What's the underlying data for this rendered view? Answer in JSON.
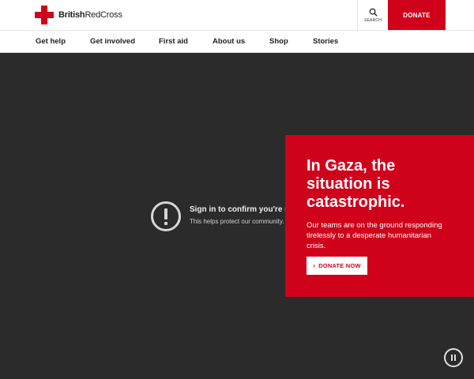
{
  "header": {
    "logo_text_bold": "British",
    "logo_text_light": "RedCross",
    "search_label": "SEARCH",
    "donate_label": "DONATE"
  },
  "nav": {
    "items": [
      "Get help",
      "Get involved",
      "First aid",
      "About us",
      "Shop",
      "Stories"
    ]
  },
  "video": {
    "signin_title": "Sign in to confirm you're not a bot",
    "signin_subtitle": "This helps protect our community."
  },
  "promo": {
    "title": "In Gaza, the situation is catastrophic.",
    "body": "Our teams are on the ground responding tirelessly to a desperate humanitarian crisis.",
    "cta_label": "DONATE NOW"
  },
  "colors": {
    "brand_red": "#d0021b",
    "video_bg": "#2b2b2b"
  }
}
